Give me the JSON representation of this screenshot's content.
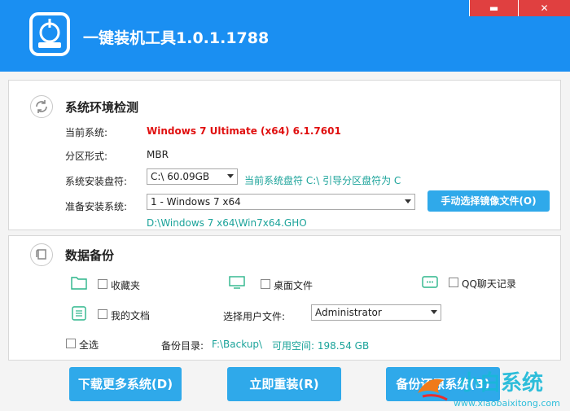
{
  "window": {
    "title": "一键装机工具1.0.1.1788",
    "minimize_glyph": "▬",
    "close_glyph": "✕"
  },
  "env": {
    "title": "系统环境检测",
    "current_system_label": "当前系统:",
    "current_system_value": "Windows 7 Ultimate (x64) 6.1.7601",
    "partition_label": "分区形式:",
    "partition_value": "MBR",
    "install_drive_label": "系统安装盘符:",
    "install_drive_value": "C:\\    60.09GB",
    "install_drive_note": "当前系统盘符 C:\\ 引导分区盘符为 C",
    "target_system_label": "准备安装系统:",
    "target_system_value": "1 - Windows 7  x64",
    "image_path": "D:\\Windows 7 x64\\Win7x64.GHO",
    "manual_select_button": "手动选择镜像文件(O)"
  },
  "backup": {
    "title": "数据备份",
    "favorites": "收藏夹",
    "desktop_files": "桌面文件",
    "qq_records": "QQ聊天记录",
    "my_documents": "我的文档",
    "select_user_label": "选择用户文件:",
    "user_value": "Administrator",
    "select_all": "全选",
    "backup_dir_label": "备份目录:",
    "backup_dir_value": "F:\\Backup\\",
    "free_space": "可用空间: 198.54 GB"
  },
  "actions": {
    "download_more": "下载更多系统(D)",
    "reinstall_now": "立即重装(R)",
    "backup_restore": "备份还原系统(B)"
  },
  "watermark": {
    "brand": "小白系统",
    "url": "www.xiaobaixitong.com"
  },
  "colors": {
    "accent": "#1a8ff2",
    "button": "#2fa9ea",
    "highlight_red": "#e01010",
    "teal": "#1ba39a",
    "close_red": "#e04040"
  }
}
